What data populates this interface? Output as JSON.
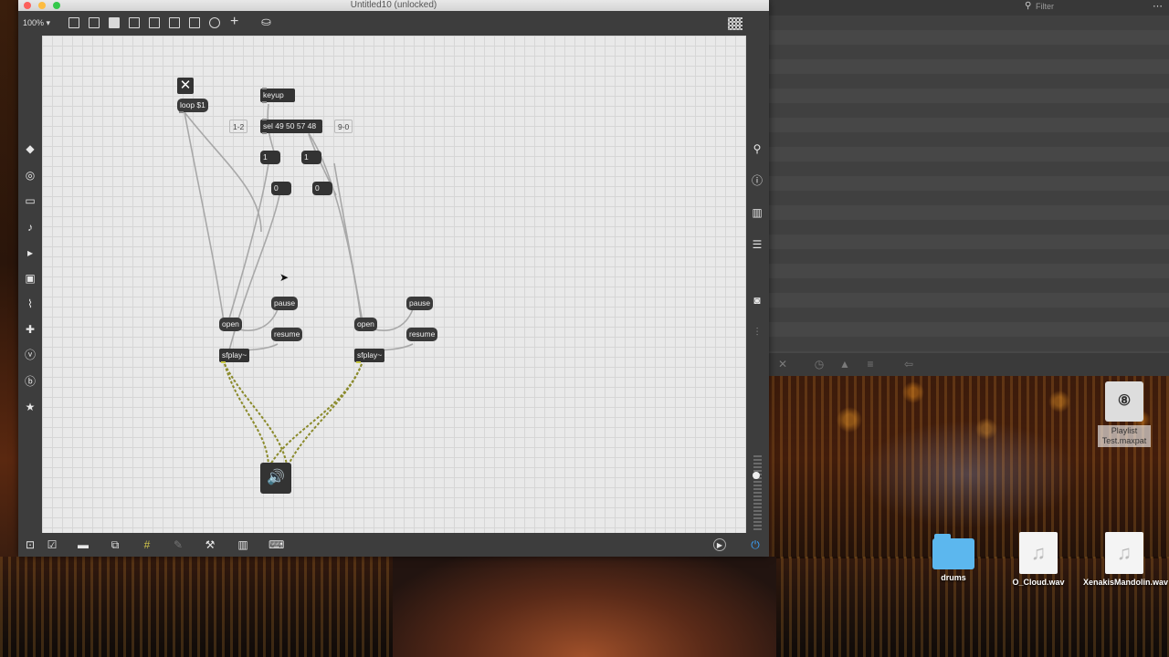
{
  "window": {
    "title": "Untitled10 (unlocked)",
    "zoom": "100%"
  },
  "toolbar": {
    "icons": [
      "new-object-icon",
      "message-icon",
      "comment-icon",
      "button-icon",
      "toggle-icon",
      "number-icon",
      "slider-icon",
      "dial-icon",
      "add-icon",
      "paint-bucket-icon",
      "grid-icon"
    ]
  },
  "patch": {
    "toggle_symbol": "✕",
    "loop_msg": "loop $1",
    "keyup": "keyup",
    "sel": "sel 49 50 57 48",
    "comment_left": "1-2",
    "comment_right": "9-0",
    "num_a": "1",
    "num_b": "1",
    "num_c": "0",
    "num_d": "0",
    "pause_a": "pause",
    "resume_a": "resume",
    "open_a": "open",
    "sfplay_a": "sfplay~",
    "pause_b": "pause",
    "resume_b": "resume",
    "open_b": "open",
    "sfplay_b": "sfplay~",
    "dac_symbol": "🔊"
  },
  "left_sidebar": {
    "icons": [
      "packages-icon",
      "target-icon",
      "media-icon",
      "music-note-icon",
      "audio-icon",
      "image-icon",
      "clip-icon",
      "puzzle-icon",
      "v-icon",
      "b-icon",
      "star-icon"
    ]
  },
  "right_sidebar": {
    "icons": [
      "search-icon",
      "info-icon",
      "book-icon",
      "list-icon",
      "camera-icon",
      "mixer-icon"
    ]
  },
  "bottom_toolbar": {
    "icons": [
      "lock-icon",
      "edit-icon",
      "presentation-icon",
      "layers-icon",
      "grid-snap-icon",
      "debug-icon",
      "wrench-icon",
      "piano-icon",
      "keyboard-icon",
      "play-icon",
      "power-icon"
    ]
  },
  "right_panel": {
    "filter_placeholder": "Filter",
    "footer_icons": [
      "close-icon",
      "clock-icon",
      "warning-icon",
      "list-icon",
      "back-icon"
    ]
  },
  "desktop": {
    "items": [
      {
        "label": "Playlist Test.maxpat",
        "type": "patch"
      },
      {
        "label": "drums",
        "type": "folder"
      },
      {
        "label": "O_Cloud.wav",
        "type": "audio"
      },
      {
        "label": "XenakisMandolin.wav",
        "type": "audio"
      }
    ],
    "music_symbol": "♫"
  },
  "colors": {
    "canvas_bg": "#e9e9e9",
    "object_bg": "#333333",
    "toolbar_bg": "#3d3d3d",
    "signal_cord": "#8a8a2a"
  }
}
